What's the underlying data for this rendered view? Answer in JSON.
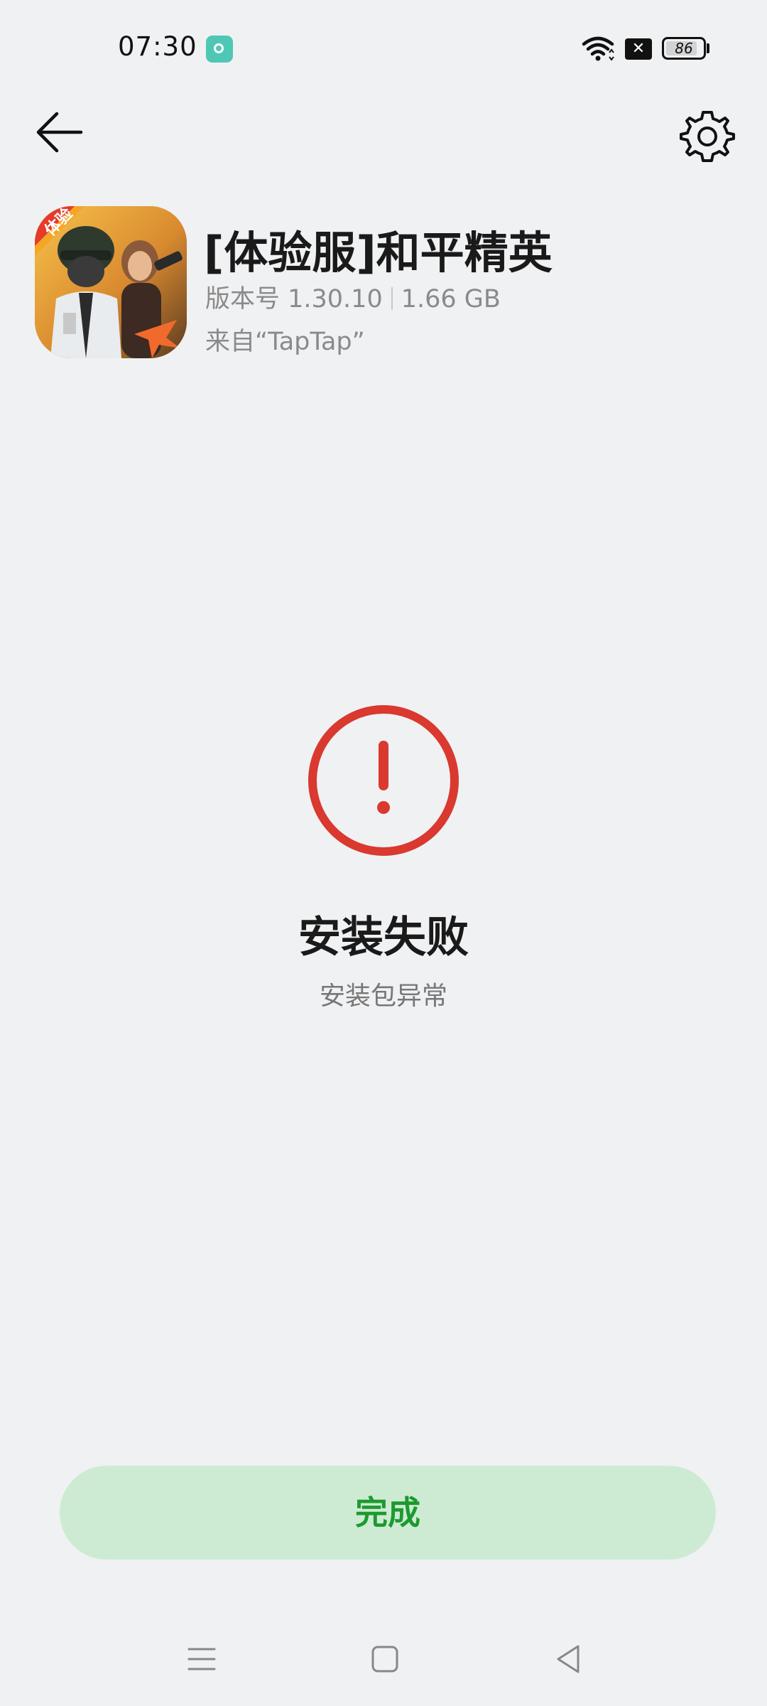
{
  "status_bar": {
    "time": "07:30",
    "battery_level": "86",
    "battery_percent": 86,
    "icons": [
      "app-notification-icon",
      "wifi-icon",
      "sim-disabled-icon",
      "battery-icon"
    ],
    "x_badge_glyph": "✕"
  },
  "header": {
    "back_icon": "arrow-left-icon",
    "settings_icon": "gear-icon"
  },
  "app": {
    "badge_text": "体验",
    "name": "[体验服]和平精英",
    "version": "版本号 1.30.10",
    "size": "1.66 GB",
    "source": "来自“TapTap”"
  },
  "result": {
    "icon": "exclamation-circle-icon",
    "title": "安装失败",
    "subtitle": "安装包异常"
  },
  "actions": {
    "done_label": "完成"
  },
  "nav": {
    "items": [
      "menu-icon",
      "home-icon",
      "back-icon"
    ]
  },
  "colors": {
    "background": "#f0f1f3",
    "error_red": "#d9392f",
    "button_bg": "#cdebd3",
    "button_text": "#1c9a2e"
  }
}
